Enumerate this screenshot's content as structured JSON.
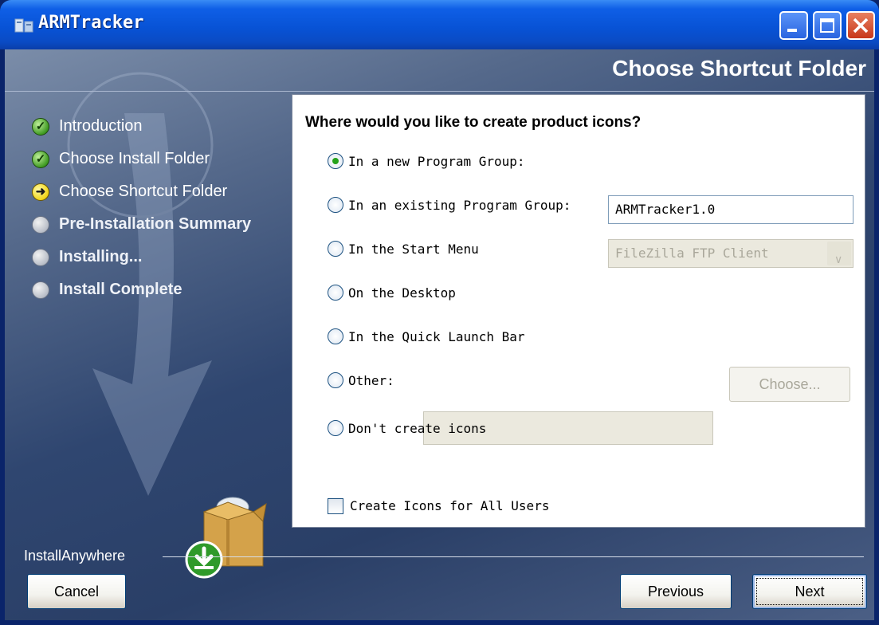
{
  "window": {
    "title": "ARMTracker",
    "controls": {
      "minimize": "minimize",
      "maximize": "maximize",
      "close": "close"
    }
  },
  "header": {
    "title": "Choose Shortcut Folder"
  },
  "steps": [
    {
      "label": "Introduction",
      "status": "done"
    },
    {
      "label": "Choose Install Folder",
      "status": "done"
    },
    {
      "label": "Choose Shortcut Folder",
      "status": "current"
    },
    {
      "label": "Pre-Installation Summary",
      "status": "pending"
    },
    {
      "label": "Installing...",
      "status": "pending"
    },
    {
      "label": "Install Complete",
      "status": "pending"
    }
  ],
  "panel": {
    "question": "Where would you like to create product icons?",
    "options": [
      {
        "label": "In a new Program Group:",
        "selected": true
      },
      {
        "label": "In an existing Program Group:",
        "selected": false
      },
      {
        "label": "In the Start Menu",
        "selected": false
      },
      {
        "label": "On the Desktop",
        "selected": false
      },
      {
        "label": "In the Quick Launch Bar",
        "selected": false
      },
      {
        "label": "Other:",
        "selected": false
      },
      {
        "label": "Don't create icons",
        "selected": false
      }
    ],
    "new_group_value": "ARMTracker1.0",
    "existing_group_value": "FileZilla FTP Client",
    "other_value": "",
    "choose_button": "Choose...",
    "all_users_label": "Create Icons for All Users",
    "all_users_checked": false
  },
  "footer": {
    "brand": "InstallAnywhere",
    "cancel": "Cancel",
    "previous": "Previous",
    "next": "Next"
  },
  "colors": {
    "titlebar": "#0853d6",
    "radio_selected": "#24a21b",
    "step_done": "#3f9a22",
    "step_current": "#f2d61a"
  }
}
